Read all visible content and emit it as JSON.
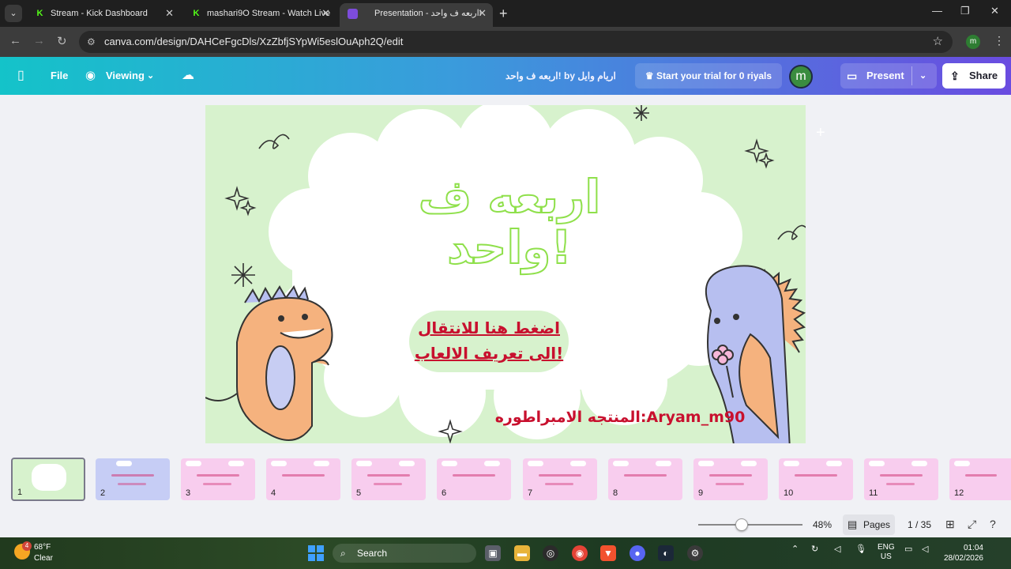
{
  "browser": {
    "tabs": [
      {
        "title": "Stream - Kick Dashboard",
        "favicon": "kick-icon"
      },
      {
        "title": "mashari9O Stream - Watch Live",
        "favicon": "kick-icon"
      },
      {
        "title": "Presentation - اربعه ف واحد!",
        "favicon": "canva-icon"
      }
    ],
    "url": "canva.com/design/DAHCeFgcDls/XzZbfjSYpWi5eslOuAph2Q/edit",
    "profile_initial": "m"
  },
  "toolbar": {
    "file": "File",
    "viewing": "Viewing",
    "title": "اربعه ف واحد! by اريام وايل",
    "trial": "Start your trial for 0 riyals",
    "avatar_initial": "m",
    "present": "Present",
    "share": "Share",
    "brand_gradient": [
      "#14c3c9",
      "#6a4ce0"
    ]
  },
  "slide": {
    "title": "اربعه ف واحد!",
    "cta_line1": "اضغط هنا للانتقال",
    "cta_line2": "الى تعريف الالعاب!",
    "credit": "المنتجه الامبراطوره:Aryam_m90",
    "colors": {
      "background": "#d7f2cd",
      "title_outline": "#8fe04b",
      "accent_red": "#c8102e",
      "dino_left": "#f5b27e",
      "dino_right": "#b7bff0"
    }
  },
  "pages": {
    "thumbnails": [
      "1",
      "2",
      "3",
      "4",
      "5",
      "6",
      "7",
      "8",
      "9",
      "10",
      "11",
      "12"
    ],
    "current_page": 1,
    "total_pages": 35,
    "page_counter": "1 / 35",
    "zoom": "48%",
    "zoom_fraction": 0.42,
    "pages_button": "Pages"
  },
  "taskbar": {
    "weather_badge": "4",
    "temperature": "68°F",
    "condition": "Clear",
    "search": "Search",
    "language_line1": "ENG",
    "language_line2": "US",
    "time": "01:04",
    "date": "28/02/2026"
  }
}
